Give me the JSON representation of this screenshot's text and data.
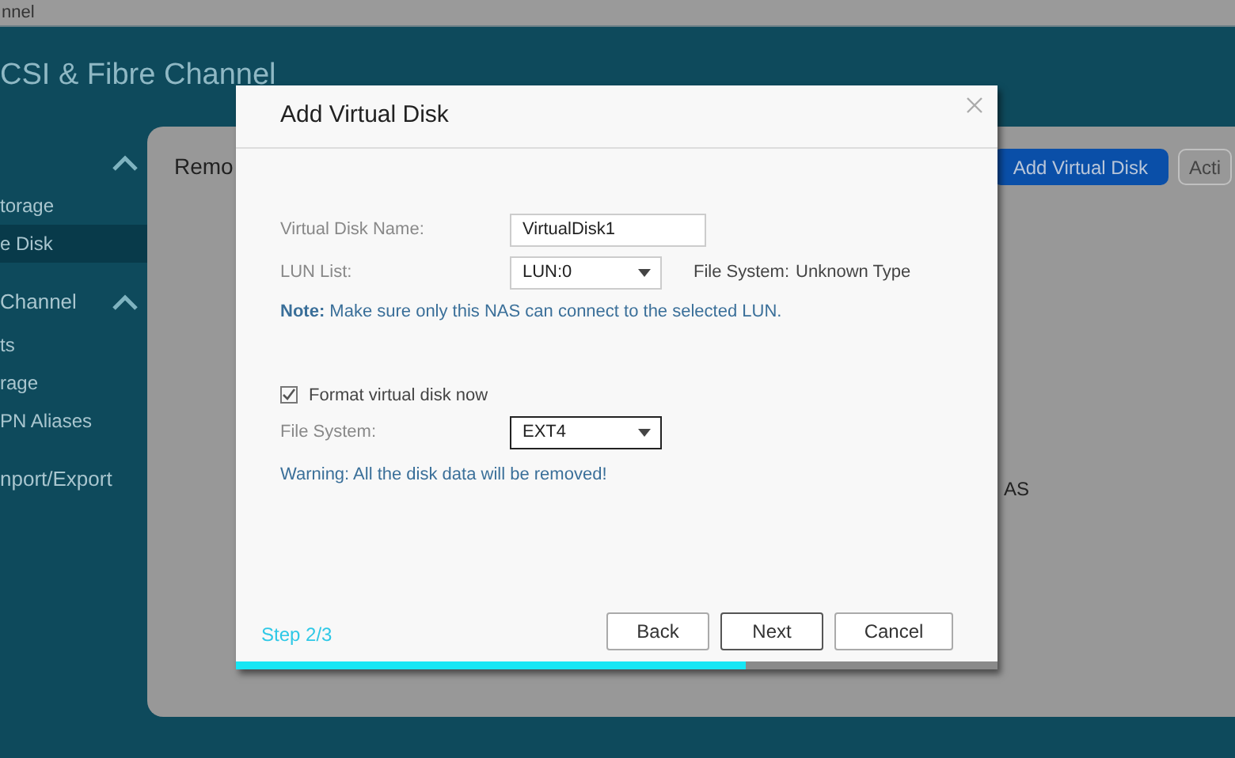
{
  "window": {
    "title": "nnel"
  },
  "app_title": "CSI & Fibre Channel",
  "sidebar": {
    "groups": [
      {
        "expanded": true,
        "items": [
          {
            "label": "torage",
            "selected": false
          },
          {
            "label": "e Disk",
            "selected": true
          }
        ]
      },
      {
        "label": "Channel",
        "expanded": true,
        "items": [
          {
            "label": "ts",
            "selected": false
          },
          {
            "label": "rage",
            "selected": false
          },
          {
            "label": "PN Aliases",
            "selected": false
          }
        ]
      },
      {
        "label": "nport/Export"
      }
    ]
  },
  "main": {
    "heading": "Remo",
    "buttons": [
      {
        "label": "Add Virtual Disk",
        "kind": "primary"
      },
      {
        "label": "Acti",
        "kind": "outline"
      }
    ],
    "fragment": "AS"
  },
  "dialog": {
    "title": "Add Virtual Disk",
    "name_label": "Virtual Disk Name:",
    "name_value": "VirtualDisk1",
    "lun_label": "LUN List:",
    "lun_value": "LUN:0",
    "fs_info_label": "File System:",
    "fs_info_value": "Unknown Type",
    "note": "**Note:** Make sure only this NAS can connect to the selected LUN.",
    "format": {
      "label": "Format virtual disk now",
      "checked": true
    },
    "fs_label": "File System:",
    "fs_value": "EXT4",
    "warning": "Warning: All the disk data will be removed!",
    "step": "Step 2/3",
    "progress": {
      "level": 0.67
    },
    "buttons": [
      "Back",
      "Next",
      "Cancel"
    ]
  }
}
